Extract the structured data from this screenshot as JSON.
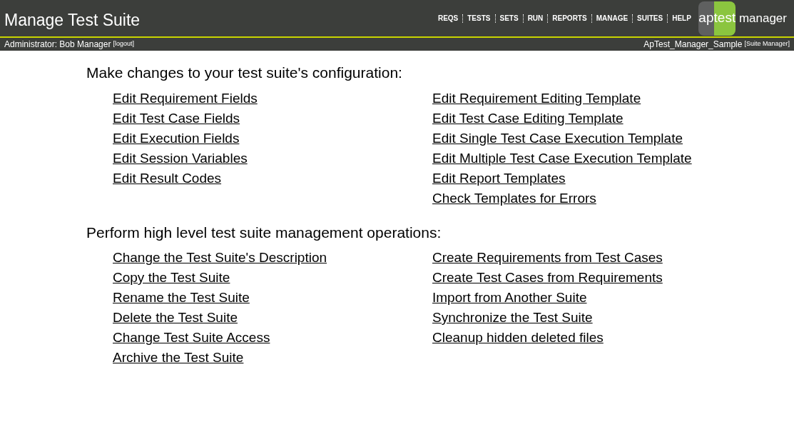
{
  "header": {
    "title": "Manage Test Suite",
    "nav": [
      "REQS",
      "TESTS",
      "SETS",
      "RUN",
      "REPORTS",
      "MANAGE",
      "SUITES",
      "HELP"
    ],
    "logo": {
      "left": "ap",
      "right": "test",
      "word": "manager"
    }
  },
  "subbar": {
    "user": "Administrator: Bob Manager",
    "logout": "[logout]",
    "suite": "ApTest_Manager_Sample",
    "role": "[Suite Manager]"
  },
  "sections": [
    {
      "heading": "Make changes to your test suite's configuration:",
      "left": [
        "Edit Requirement Fields",
        "Edit Test Case Fields",
        "Edit Execution Fields",
        "Edit Session Variables",
        "Edit Result Codes"
      ],
      "right": [
        "Edit Requirement Editing Template",
        "Edit Test Case Editing Template",
        "Edit Single Test Case Execution Template",
        "Edit Multiple Test Case Execution Template",
        "Edit Report Templates",
        "Check Templates for Errors"
      ]
    },
    {
      "heading": "Perform high level test suite management operations:",
      "left": [
        "Change the Test Suite's Description",
        "Copy the Test Suite",
        "Rename the Test Suite",
        "Delete the Test Suite",
        "Change Test Suite Access",
        "Archive the Test Suite"
      ],
      "right": [
        "Create Requirements from Test Cases",
        "Create Test Cases from Requirements",
        "Import from Another Suite",
        "Synchronize the Test Suite",
        "Cleanup hidden deleted files"
      ]
    }
  ]
}
